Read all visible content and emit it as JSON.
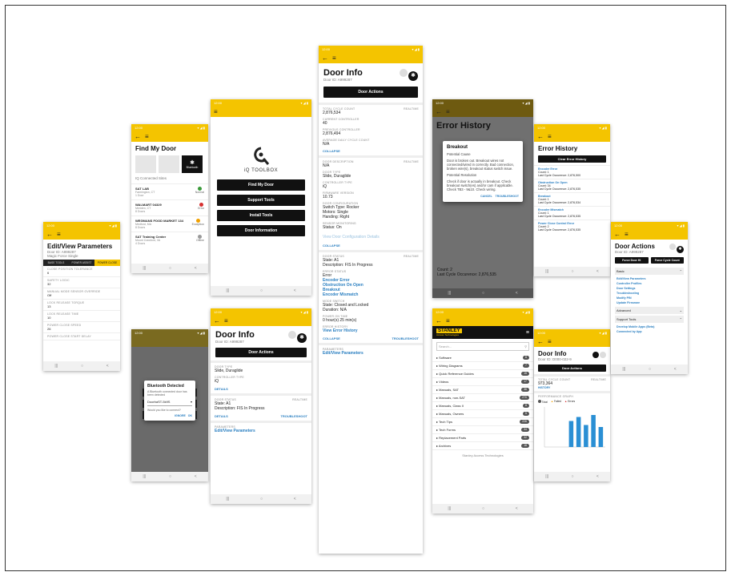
{
  "common": {
    "status_time": "12:00",
    "status_icons": "▾ ◢ ▮",
    "back_icon": "←",
    "menu_icon": "≡",
    "nav": [
      "|||",
      "○",
      "<"
    ]
  },
  "ph1": {
    "title": "Edit/View Parameters",
    "door_id": "Door ID: A999287",
    "door_model": "Magic Force Single",
    "tabs": [
      "BASE TOOLS",
      "POWER ASSIST",
      "POWER CLOSE"
    ],
    "params": [
      {
        "label": "CLOSE POSITION TOLERANCE",
        "value": "6"
      },
      {
        "label": "SAFETY LOGIC",
        "value": "32"
      },
      {
        "label": "MANUAL MODE SENSOR OVERRIDE",
        "value": "Off"
      },
      {
        "label": "LOCK RELEASE TORQUE",
        "value": "13"
      },
      {
        "label": "LOCK RELEASE TIME",
        "value": "10"
      },
      {
        "label": "POWER CLOSE SPEED",
        "value": "26"
      },
      {
        "label": "POWER CLOSE START DELAY",
        "value": ""
      }
    ]
  },
  "ph2": {
    "title": "Find My Door",
    "bt_label": "Bluetooth",
    "connected": "IQ Connected Sites",
    "sites": [
      {
        "name": "SAT LAB",
        "loc": "Farmington, CT",
        "dist": "1 Door",
        "status": "Normal",
        "color": "#3a9a3a"
      },
      {
        "name": "WALMART 04329",
        "loc": "Meriden, CT",
        "dist": "8 Doors",
        "status": "Error",
        "color": "#d63030"
      },
      {
        "name": "WEGMANS FOOD MARKET 134",
        "loc": "Medford, MA",
        "dist": "8 Doors",
        "status": "Exception",
        "color": "#f0a000"
      },
      {
        "name": "SAT Training Center",
        "loc": "Mount Crawford, VA",
        "dist": "4 Doors",
        "status": "Offline",
        "color": "#999999"
      }
    ]
  },
  "ph3": {
    "brand": "iQ TOOLBOX",
    "buttons": [
      "Find My Door",
      "Support Tools",
      "Install Tools",
      "Door Information"
    ]
  },
  "ph4": {
    "dialog_title": "Bluetooth Detected",
    "dialog_text": "A Bluetooth connected door has been detected",
    "select": "DoorbaST-5k9S",
    "question": "Would you like to connect?",
    "cancel": "IGNORE",
    "ok": "OK"
  },
  "ph5": {
    "title": "Door Info",
    "door_id": "Door ID: A999287",
    "actions": "Door Actions",
    "door_type_lbl": "DOOR TYPE",
    "door_type": "Slide, Duraglide",
    "ctrl_lbl": "CONTROLLER TYPE",
    "ctrl": "iQ",
    "details": "DETAILS",
    "status_lbl": "DOOR STATUS",
    "realtime": "Realtime",
    "state": "State: A1",
    "desc": "Description: FIS In Progress",
    "troubleshoot": "TROUBLESHOOT",
    "params_lbl": "PARAMETERS",
    "params_link": "Edit/View Parameters"
  },
  "ph6": {
    "title": "Door Info",
    "door_id": "Door ID: A999287",
    "actions": "Door Actions",
    "s1": [
      {
        "l": "TOTAL CYCLE COUNT",
        "v": "2,876,534"
      },
      {
        "l": "CURRENT CONTROLLER",
        "v": "40"
      },
      {
        "l": "PREVIOUS CONTROLLER",
        "v": "2,876,494"
      },
      {
        "l": "AVERAGE DAILY CYCLE COUNT",
        "v": "N/A"
      }
    ],
    "collapse": "COLLAPSE",
    "realtime": "Realtime",
    "s2": [
      {
        "l": "DOOR DESCRIPTION",
        "v": "N/A"
      },
      {
        "l": "DOOR TYPE",
        "v": "Slide, Duraglide"
      },
      {
        "l": "CONTROLLER TYPE",
        "v": "iQ"
      },
      {
        "l": "FIRMWARE VERSION",
        "v": "10.73"
      }
    ],
    "cfg_lbl": "DOOR CONFIGURATION",
    "cfg": [
      "Switch Type: Rocker",
      "Motors: Single",
      "Handing: Right"
    ],
    "sensor_lbl": "SENSOR MONITORING",
    "sensor": "Status: On",
    "view_cfg": "View Door Configuration Details",
    "status_lbl": "DOOR STATUS",
    "state": "State: A1",
    "desc": "Description: FIS In Progress",
    "err_lbl": "ERROR STATUS",
    "err": "Error",
    "errs": [
      "Encoder Error",
      "Obstruction On Open",
      "Breakout",
      "Encoder Mismatch"
    ],
    "mode_lbl": "MODE SWITCH",
    "mode": "State: Closed and Locked",
    "dur": "Duration: N/A",
    "pot_lbl": "POWER ON TIME",
    "pot": "0 hour(s) 25 min(s)",
    "eh_lbl": "ERROR HISTORY",
    "eh": "View Error History",
    "troubleshoot": "TROUBLESHOOT",
    "params_lbl": "PARAMETERS",
    "params_link": "Edit/View Parameters"
  },
  "ph7": {
    "title": "Error History",
    "dlg_title": "Breakout",
    "cause_lbl": "Potential Cause",
    "cause": "Door is broken out. Breakout wires not connected/wired in correctly. Bad connection, broken wire(s), breakout status switch issue.",
    "res_lbl": "Potential Resolution",
    "res": "Check if door is actually in breakout. Check breakout switch(es) and/or cam if applicable. Check TB3 - 9&10. Check wiring.",
    "cancel": "CANCEL",
    "trouble": "TROUBLESHOOT",
    "count": "Count: 2",
    "last": "Last Cycle Occurence: 2,876,535"
  },
  "ph8": {
    "brand": "STANLEY",
    "brand_sub": "Access Technologies",
    "search": "Search...",
    "items": [
      {
        "n": "Software",
        "c": "8"
      },
      {
        "n": "Wiring Diagrams",
        "c": "7"
      },
      {
        "n": "Quick Reference Guides",
        "c": "15"
      },
      {
        "n": "Videos",
        "c": "17"
      },
      {
        "n": "Manuals, SAT",
        "c": "36"
      },
      {
        "n": "Manuals, non-SAT",
        "c": "270"
      },
      {
        "n": "Manuals, Class II",
        "c": "8"
      },
      {
        "n": "Manuals, Owners",
        "c": "5"
      },
      {
        "n": "Tech Tips",
        "c": "226"
      },
      {
        "n": "Tech Forms",
        "c": "34"
      },
      {
        "n": "Replacement Parts",
        "c": "32"
      },
      {
        "n": "Archives",
        "c": "18"
      }
    ],
    "footer": "Stanley Access Technologies"
  },
  "ph9": {
    "title": "Error History",
    "clear": "Clear Error History",
    "errors": [
      {
        "n": "Encoder Error",
        "c": "Count: 1",
        "o": "Last Cycle Occurence: 2,876,500"
      },
      {
        "n": "Obstruction On Open",
        "c": "Count: 34",
        "o": "Last Cycle Occurence: 2,876,535"
      },
      {
        "n": "Breakout",
        "c": "Count: 1",
        "o": "Last Cycle Occurence: 2,876,534"
      },
      {
        "n": "Encoder Mismatch",
        "c": "Count: 1",
        "o": "Last Cycle Occurence: 2,876,535"
      },
      {
        "n": "Power Close Control Error",
        "c": "Count: 2",
        "o": "Last Cycle Occurence: 2,876,535"
      }
    ]
  },
  "ph10": {
    "title": "Door Info",
    "door_id": "Door ID: D000-022-9",
    "actions": "Door Actions",
    "tcc_lbl": "TOTAL CYCLE COUNT",
    "tcc": "973,364",
    "realtime": "Realtime",
    "hist": "HISTORY",
    "perf": "PERFORMANCE GRAPH",
    "legend": [
      "Total",
      "Failed",
      "Errors"
    ]
  },
  "chart_data": {
    "type": "bar",
    "categories": [
      "1",
      "2",
      "3",
      "4",
      "5",
      "6",
      "7",
      "8"
    ],
    "values": [
      0,
      0,
      0,
      65,
      75,
      55,
      80,
      50
    ],
    "ylim": [
      0,
      100
    ],
    "color": "#2a8fd4"
  },
  "ph11": {
    "title": "Door Actions",
    "door_id": "Door ID: A999287",
    "b1": "Force Door Hi",
    "b2": "Force Cycle Count",
    "basic": "Basic",
    "basic_items": [
      "Edit/View Parameters",
      "Controller Profiles",
      "Door Settings",
      "Troubleshooting",
      "Modify PIN",
      "Update Firmware"
    ],
    "advanced": "Advanced",
    "support": "Support Tools",
    "support_items": [
      "Develop Mobile Apps (Beta)",
      "Connected by App"
    ]
  }
}
